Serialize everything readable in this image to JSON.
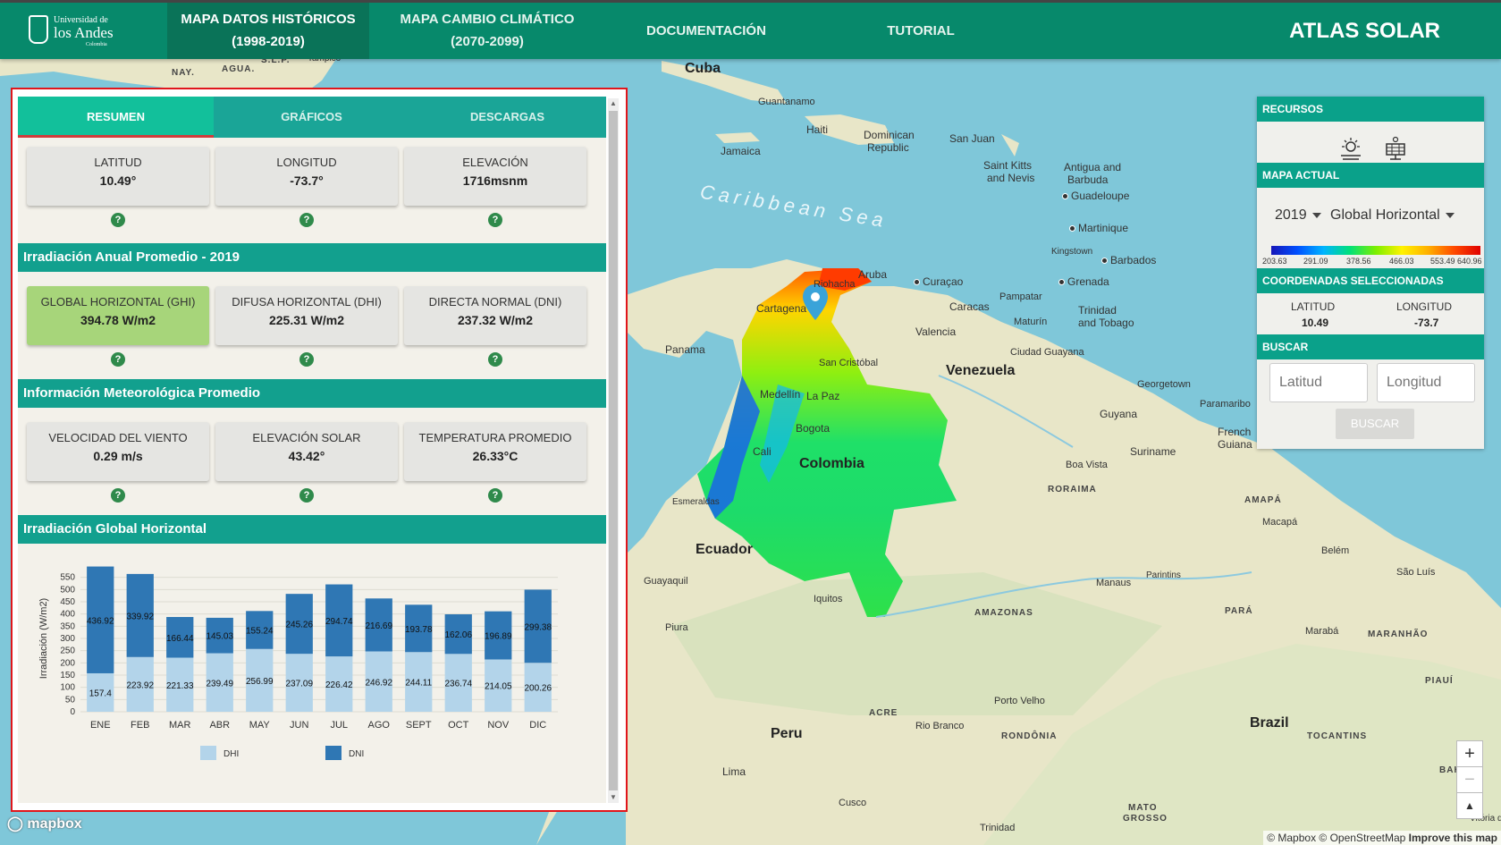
{
  "nav": {
    "logo": {
      "line1": "Universidad de",
      "line2": "los Andes",
      "line3": "Colombia"
    },
    "tabs": [
      {
        "line1": "MAPA DATOS HISTÓRICOS",
        "line2": "(1998-2019)"
      },
      {
        "line1": "MAPA CAMBIO CLIMÁTICO",
        "line2": "(2070-2099)"
      },
      {
        "line1": "DOCUMENTACIÓN"
      },
      {
        "line1": "TUTORIAL"
      }
    ],
    "app_title": "ATLAS SOLAR"
  },
  "panel": {
    "tabs": [
      "RESUMEN",
      "GRÁFICOS",
      "DESCARGAS"
    ],
    "location": [
      {
        "label": "LATITUD",
        "value": "10.49°"
      },
      {
        "label": "LONGITUD",
        "value": "-73.7°"
      },
      {
        "label": "ELEVACIÓN",
        "value": "1716msnm"
      }
    ],
    "section_irradiation": "Irradiación Anual Promedio - 2019",
    "irradiation": [
      {
        "label": "GLOBAL HORIZONTAL (GHI)",
        "value": "394.78 W/m2"
      },
      {
        "label": "DIFUSA HORIZONTAL (DHI)",
        "value": "225.31 W/m2"
      },
      {
        "label": "DIRECTA NORMAL (DNI)",
        "value": "237.32 W/m2"
      }
    ],
    "section_meteo": "Información Meteorológica Promedio",
    "meteo": [
      {
        "label": "VELOCIDAD DEL VIENTO",
        "value": "0.29 m/s"
      },
      {
        "label": "ELEVACIÓN SOLAR",
        "value": "43.42°"
      },
      {
        "label": "TEMPERATURA PROMEDIO",
        "value": "26.33°C"
      }
    ],
    "section_chart": "Irradiación Global Horizontal",
    "help_glyph": "?"
  },
  "chart_data": {
    "type": "bar",
    "stacked": true,
    "categories": [
      "ENE",
      "FEB",
      "MAR",
      "ABR",
      "MAY",
      "JUN",
      "JUL",
      "AGO",
      "SEPT",
      "OCT",
      "NOV",
      "DIC"
    ],
    "series": [
      {
        "name": "DHI",
        "color": "#b3d4ea",
        "values": [
          157.4,
          223.92,
          221.33,
          239.49,
          256.99,
          237.09,
          226.42,
          246.92,
          244.11,
          236.74,
          214.05,
          200.26
        ]
      },
      {
        "name": "DNI",
        "color": "#2f77b4",
        "values": [
          436.92,
          339.92,
          166.44,
          145.03,
          155.24,
          245.26,
          294.74,
          216.69,
          193.78,
          162.06,
          196.89,
          299.38
        ]
      }
    ],
    "ylabel": "Irradiación (W/m2)",
    "yticks": [
      0,
      50,
      100,
      150,
      200,
      250,
      300,
      350,
      400,
      450,
      500,
      550
    ],
    "ylim": [
      0,
      600
    ],
    "legend": "bottom"
  },
  "controls": {
    "recursos": "RECURSOS",
    "mapa_actual": "MAPA ACTUAL",
    "year": "2019",
    "variable": "Global Horizontal",
    "colorbar_labels": [
      "203.63",
      "291.09",
      "378.56",
      "466.03",
      "553.49",
      "640.96"
    ],
    "coords_header": "COORDENADAS SELECCIONADAS",
    "lat_label": "LATITUD",
    "lon_label": "LONGITUD",
    "lat_value": "10.49",
    "lon_value": "-73.7",
    "buscar_header": "BUSCAR",
    "lat_placeholder": "Latitud",
    "lon_placeholder": "Longitud",
    "buscar_button": "BUSCAR"
  },
  "map": {
    "labels": {
      "cuba": "Cuba",
      "guantanamo": "Guantanamo",
      "jamaica": "Jamaica",
      "haiti": "Haiti",
      "dominican": "Dominican",
      "republic": "Republic",
      "sanjuan": "San Juan",
      "stkitts": "Saint Kitts",
      "nevis": "and Nevis",
      "antigua": "Antigua and",
      "barbuda": "Barbuda",
      "guadeloupe": "Guadeloupe",
      "martinique": "Martinique",
      "kingstown": "Kingstown",
      "barbados": "Barbados",
      "grenada": "Grenada",
      "caribbean": "Caribbean Sea",
      "aruba": "Aruba",
      "curacao": "Curaçao",
      "riohacha": "Riohacha",
      "cartagena": "Cartagena",
      "caracas": "Caracas",
      "valencia": "Valencia",
      "pampatar": "Pampatar",
      "maturin": "Maturín",
      "trinidad": "Trinidad",
      "tobago": "and Tobago",
      "panama": "Panama",
      "sancristobal": "San Cristóbal",
      "venezuela": "Venezuela",
      "ciudadguayana": "Ciudad Guayana",
      "georgetown": "Georgetown",
      "paramaribo": "Paramaribo",
      "guyana": "Guyana",
      "frenchguiana1": "French",
      "frenchguiana2": "Guiana",
      "suriname": "Suriname",
      "medellin": "Medellín",
      "lapaz": "La Paz",
      "bogota": "Bogota",
      "cali": "Cali",
      "colombia": "Colombia",
      "boavista": "Boa Vista",
      "roraima": "RORAIMA",
      "amapa": "AMAPÁ",
      "macapa": "Macapá",
      "belem": "Belém",
      "esmeraldas": "Esmeraldas",
      "ecuador": "Ecuador",
      "guayaquil": "Guayaquil",
      "manaus": "Manaus",
      "parintins": "Parintins",
      "saoluis": "São Luís",
      "iquitos": "Iquitos",
      "amazonas": "AMAZONAS",
      "para": "PARÁ",
      "maraba": "Marabá",
      "maranhao": "MARANHÃO",
      "piura": "Piura",
      "piaui": "PIAUÍ",
      "acre": "ACRE",
      "portovelho": "Porto Velho",
      "riobranco": "Rio Branco",
      "brazil": "Brazil",
      "peru": "Peru",
      "rondonia": "RONDÔNIA",
      "tocantins": "TOCANTINS",
      "lima": "Lima",
      "bah": "BAH",
      "cusco": "Cusco",
      "matogrosso1": "MATO",
      "matogrosso2": "GROSSO",
      "trinidadbo": "Trinidad",
      "nay": "NAY.",
      "agua": "AGUA.",
      "slp": "S.L.P.",
      "tampico": "Tampico",
      "vitoria": "Vitória d"
    },
    "attribution": "© Mapbox © OpenStreetMap",
    "improve": "Improve this map",
    "mapbox": "mapbox",
    "zoom_in": "+",
    "zoom_out": "−",
    "compass": "▲"
  }
}
